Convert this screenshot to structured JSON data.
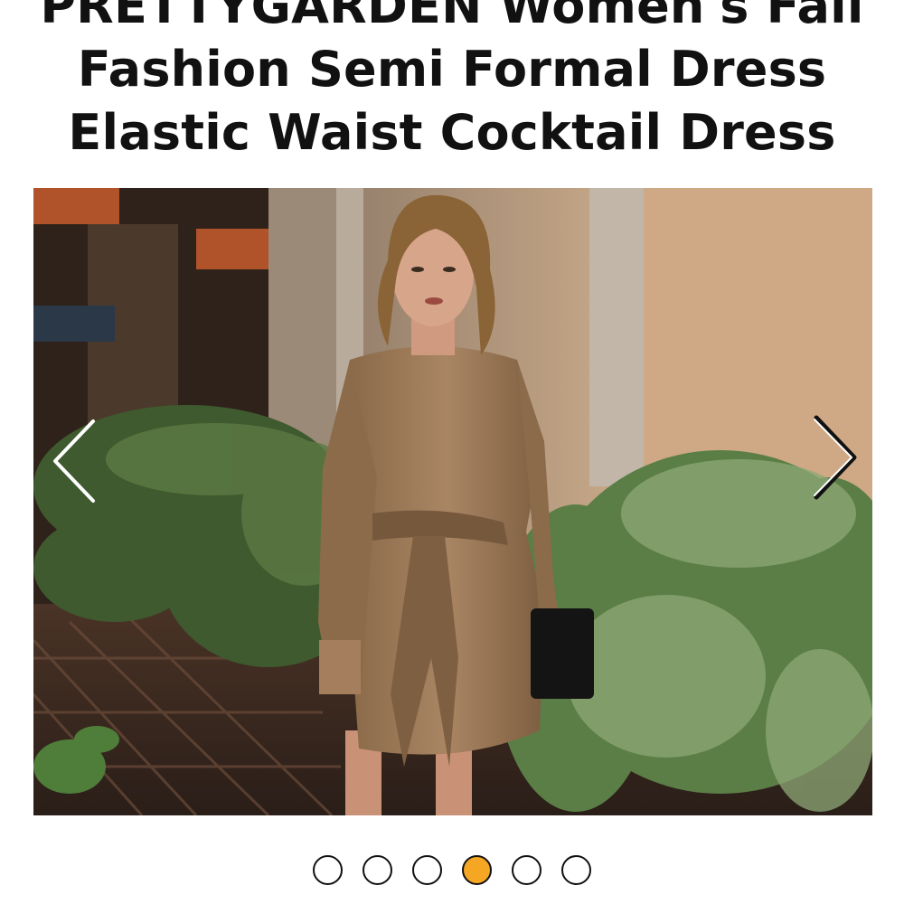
{
  "product": {
    "title_lines": [
      "PRETTYGARDEN Women's Fall",
      "Fashion Semi Formal Dress",
      "Elastic Waist Cocktail Dress"
    ]
  },
  "carousel": {
    "image_icon": "product-photo-woman-brown-dress",
    "prev_icon": "chevron-left-icon",
    "next_icon": "chevron-right-icon",
    "total_images": 6,
    "active_index": 3,
    "active_color": "#f5a623"
  }
}
